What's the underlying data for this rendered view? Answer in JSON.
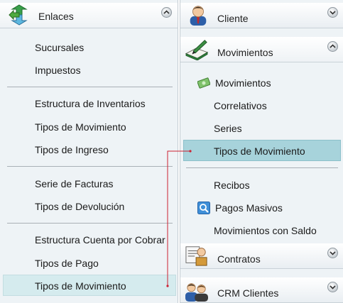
{
  "left_panel": {
    "title": "Enlaces",
    "collapse_icon": "chevron-up-icon",
    "header_icon": "green-arrows-icon",
    "items": [
      "Sucursales",
      "Impuestos",
      "Estructura de Inventarios",
      "Tipos de Movimiento",
      "Tipos de Ingreso",
      "Serie de Facturas",
      "Tipos de Devolución",
      "Estructura Cuenta por Cobrar",
      "Tipos de Pago",
      "Tipos de Movimiento"
    ],
    "selected_item": "Tipos de Movimiento"
  },
  "right_panel": {
    "sections": [
      {
        "title": "Cliente",
        "icon": "user-icon",
        "state_icon": "chevron-down-icon"
      },
      {
        "title": "Movimientos",
        "icon": "ledger-pen-icon",
        "state_icon": "chevron-up-icon"
      },
      {
        "title": "Contratos",
        "icon": "contracts-icon",
        "state_icon": "chevron-down-icon"
      },
      {
        "title": "CRM Clientes",
        "icon": "users-icon",
        "state_icon": "chevron-down-icon"
      }
    ],
    "movimientos_items": [
      {
        "label": "Movimientos",
        "icon": "money-icon"
      },
      {
        "label": "Correlativos"
      },
      {
        "label": "Series"
      },
      {
        "label": "Tipos de Movimiento"
      },
      {
        "label": "Recibos"
      },
      {
        "label": "Pagos Masivos",
        "icon": "search-icon"
      },
      {
        "label": "Movimientos con Saldo"
      }
    ],
    "selected_item": "Tipos de Movimiento"
  },
  "colors": {
    "panel_bg": "#eef3f6",
    "left_selection": "#d5ebee",
    "right_selection": "#a7d3db",
    "connector": "#cc2233"
  }
}
